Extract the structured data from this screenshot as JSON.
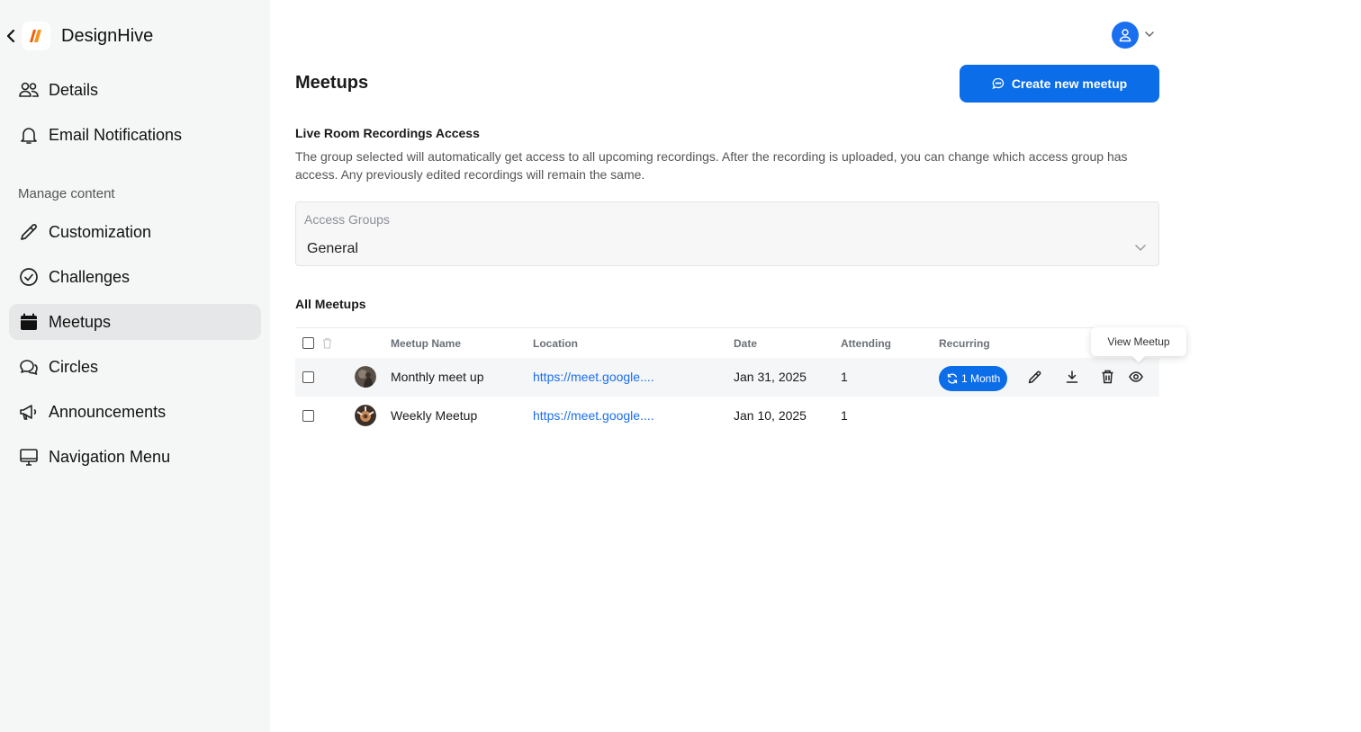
{
  "sidebar": {
    "brand": "DesignHive",
    "items": [
      {
        "label": "Details",
        "icon": "users-icon"
      },
      {
        "label": "Email Notifications",
        "icon": "bell-icon"
      }
    ],
    "section_label": "Manage content",
    "content_items": [
      {
        "label": "Customization",
        "icon": "pencil-icon"
      },
      {
        "label": "Challenges",
        "icon": "check-circle-icon"
      },
      {
        "label": "Meetups",
        "icon": "calendar-icon",
        "active": true
      },
      {
        "label": "Circles",
        "icon": "chat-bubbles-icon"
      },
      {
        "label": "Announcements",
        "icon": "megaphone-icon"
      },
      {
        "label": "Navigation Menu",
        "icon": "monitor-icon"
      }
    ]
  },
  "header": {
    "avatar_icon": "user-icon"
  },
  "main": {
    "title": "Meetups",
    "create_button": "Create new meetup",
    "recordings": {
      "title": "Live Room Recordings Access",
      "description": "The group selected will automatically get access to all upcoming recordings. After the recording is uploaded, you can change which access group has access. Any previously edited recordings will remain the same."
    },
    "access_groups": {
      "label": "Access Groups",
      "value": "General"
    },
    "meetups_title": "All Meetups",
    "table": {
      "columns": [
        "Meetup Name",
        "Location",
        "Date",
        "Attending",
        "Recurring"
      ],
      "rows": [
        {
          "name": "Monthly meet up",
          "location": "https://meet.google....",
          "date": "Jan 31, 2025",
          "attending": "1",
          "recurring": "1 Month"
        },
        {
          "name": "Weekly Meetup",
          "location": "https://meet.google....",
          "date": "Jan 10, 2025",
          "attending": "1",
          "recurring": ""
        }
      ]
    },
    "tooltip": "View Meetup"
  },
  "colors": {
    "accent": "#0b6de8",
    "link": "#1a6ff0",
    "sidebar_bg": "#f5f6f6",
    "active_bg": "#e6e7e8"
  }
}
